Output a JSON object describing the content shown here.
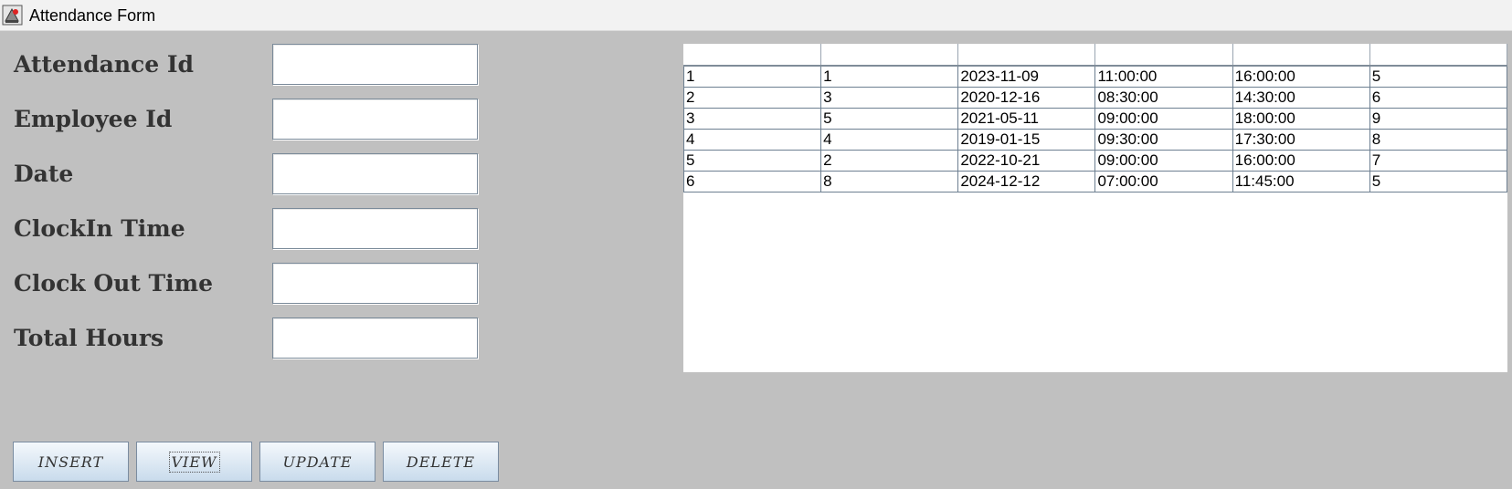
{
  "window": {
    "title": "Attendance Form"
  },
  "form": {
    "fields": [
      {
        "label": "Attendance Id",
        "value": ""
      },
      {
        "label": "Employee Id",
        "value": ""
      },
      {
        "label": "Date",
        "value": ""
      },
      {
        "label": "ClockIn Time",
        "value": ""
      },
      {
        "label": "Clock Out Time",
        "value": ""
      },
      {
        "label": "Total Hours",
        "value": ""
      }
    ]
  },
  "buttons": {
    "insert": "INSERT",
    "view": "VIEW",
    "update": "UPDATE",
    "delete": "DELETE"
  },
  "table": {
    "headers": [
      "",
      "",
      "",
      "",
      "",
      ""
    ],
    "rows": [
      [
        "1",
        "1",
        "2023-11-09",
        "11:00:00",
        "16:00:00",
        "5"
      ],
      [
        "2",
        "3",
        "2020-12-16",
        "08:30:00",
        "14:30:00",
        "6"
      ],
      [
        "3",
        "5",
        "2021-05-11",
        "09:00:00",
        "18:00:00",
        "9"
      ],
      [
        "4",
        "4",
        "2019-01-15",
        "09:30:00",
        "17:30:00",
        "8"
      ],
      [
        "5",
        "2",
        "2022-10-21",
        "09:00:00",
        "16:00:00",
        "7"
      ],
      [
        "6",
        "8",
        "2024-12-12",
        "07:00:00",
        "11:45:00",
        "5"
      ]
    ]
  }
}
